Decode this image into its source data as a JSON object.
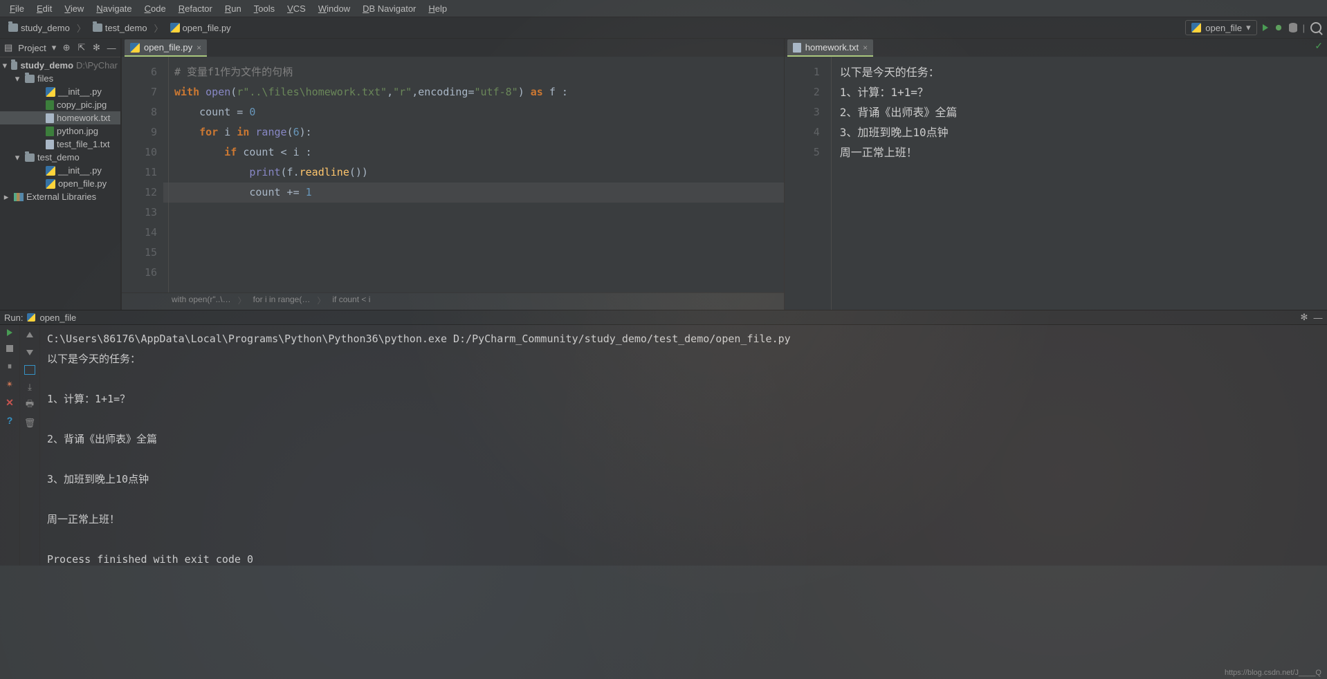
{
  "menu": [
    "File",
    "Edit",
    "View",
    "Navigate",
    "Code",
    "Refactor",
    "Run",
    "Tools",
    "VCS",
    "Window",
    "DB Navigator",
    "Help"
  ],
  "breadcrumb": {
    "items": [
      {
        "name": "study_demo",
        "icon": "folder"
      },
      {
        "name": "test_demo",
        "icon": "folder"
      },
      {
        "name": "open_file.py",
        "icon": "py"
      }
    ]
  },
  "run_config": {
    "label": "open_file"
  },
  "project_panel": {
    "title": "Project",
    "tree": {
      "root": {
        "name": "study_demo",
        "path": "D:\\PyChar"
      },
      "files_folder": "files",
      "files": [
        {
          "name": "__init__.py",
          "icon": "py"
        },
        {
          "name": "copy_pic.jpg",
          "icon": "jpg"
        },
        {
          "name": "homework.txt",
          "icon": "txt",
          "selected": true
        },
        {
          "name": "python.jpg",
          "icon": "jpg"
        },
        {
          "name": "test_file_1.txt",
          "icon": "txt"
        }
      ],
      "test_demo": "test_demo",
      "test_files": [
        {
          "name": "__init__.py",
          "icon": "py"
        },
        {
          "name": "open_file.py",
          "icon": "py"
        }
      ],
      "ext_lib": "External Libraries"
    }
  },
  "editor_left": {
    "tab": "open_file.py",
    "first_line": 6,
    "lines": [
      {
        "type": "comment",
        "text": "# 变量f1作为文件的句柄"
      },
      {
        "type": "with",
        "open": "open",
        "arg": "r\"..\\files\\homework.txt\"",
        "mode": "\"r\"",
        "enc_kw": "encoding",
        "enc_v": "\"utf-8\"",
        "as": "as",
        "var": "f"
      },
      {
        "type": "assign",
        "indent": 1,
        "lhs": "count",
        "rhs": "0"
      },
      {
        "type": "for",
        "indent": 1,
        "var": "i",
        "range_fn": "range",
        "arg": "6"
      },
      {
        "type": "if",
        "indent": 2,
        "expr": "count < i"
      },
      {
        "type": "print",
        "indent": 3,
        "call": "f.readline()"
      },
      {
        "type": "augassign",
        "indent": 3,
        "lhs": "count",
        "rhs": "1"
      }
    ],
    "crumb": [
      "with open(r\"..\\…",
      "for i in range(…",
      "if count < i"
    ]
  },
  "editor_right": {
    "tab": "homework.txt",
    "first_line": 1,
    "lines": [
      "以下是今天的任务：",
      "1、计算：1+1=？",
      "2、背诵《出师表》全篇",
      "3、加班到晚上10点钟",
      "周一正常上班！"
    ]
  },
  "run_panel": {
    "label": "Run:",
    "config": "open_file",
    "output": [
      "C:\\Users\\86176\\AppData\\Local\\Programs\\Python\\Python36\\python.exe D:/PyCharm_Community/study_demo/test_demo/open_file.py",
      "以下是今天的任务：",
      "",
      "1、计算：1+1=？",
      "",
      "2、背诵《出师表》全篇",
      "",
      "3、加班到晚上10点钟",
      "",
      "周一正常上班！",
      "",
      "Process finished with exit code 0"
    ]
  },
  "statusbar": {
    "url": "https://blog.csdn.net/J____Q"
  }
}
